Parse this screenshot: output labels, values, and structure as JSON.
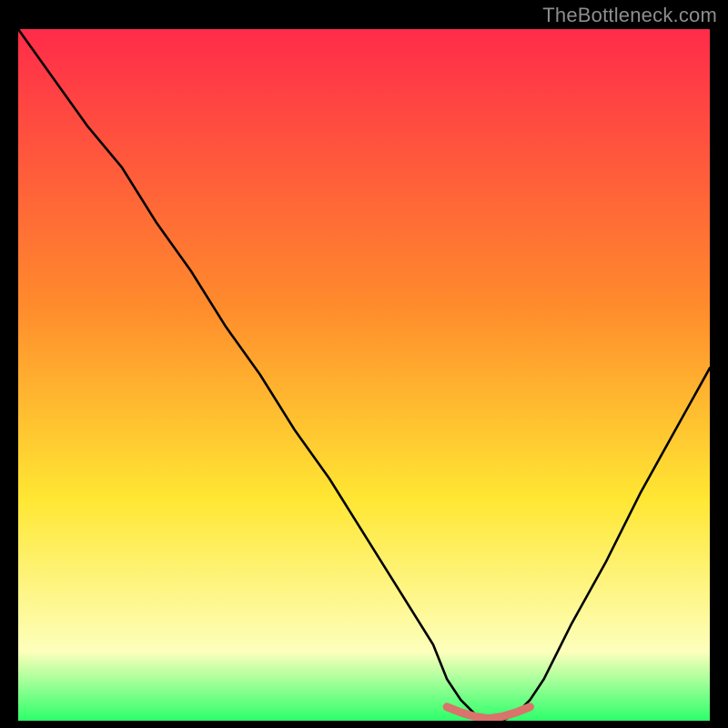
{
  "watermark": "TheBottleneck.com",
  "colors": {
    "gradient_top": "#ff2b4a",
    "gradient_mid1": "#ff8b2c",
    "gradient_mid2": "#ffe733",
    "gradient_low": "#fdffbc",
    "gradient_bottom": "#2cff6a",
    "curve": "#000000",
    "marker": "#d9736b"
  },
  "chart_data": {
    "type": "line",
    "title": "",
    "xlabel": "",
    "ylabel": "",
    "xlim": [
      0,
      100
    ],
    "ylim": [
      0,
      100
    ],
    "series": [
      {
        "name": "bottleneck-curve",
        "x": [
          0,
          5,
          10,
          15,
          20,
          25,
          30,
          35,
          40,
          45,
          50,
          55,
          60,
          62,
          64,
          66,
          68,
          70,
          72,
          74,
          76,
          78,
          80,
          85,
          90,
          95,
          100
        ],
        "values": [
          100,
          93,
          86,
          80,
          72,
          65,
          57,
          50,
          42,
          35,
          27,
          19,
          11,
          6,
          3,
          1,
          0,
          0,
          1,
          3,
          6,
          10,
          14,
          23,
          33,
          42,
          51
        ]
      },
      {
        "name": "optimal-band",
        "x": [
          62,
          64,
          66,
          68,
          70,
          72,
          74
        ],
        "values": [
          2,
          1.2,
          0.6,
          0.3,
          0.6,
          1.2,
          2
        ]
      }
    ],
    "annotations": []
  }
}
